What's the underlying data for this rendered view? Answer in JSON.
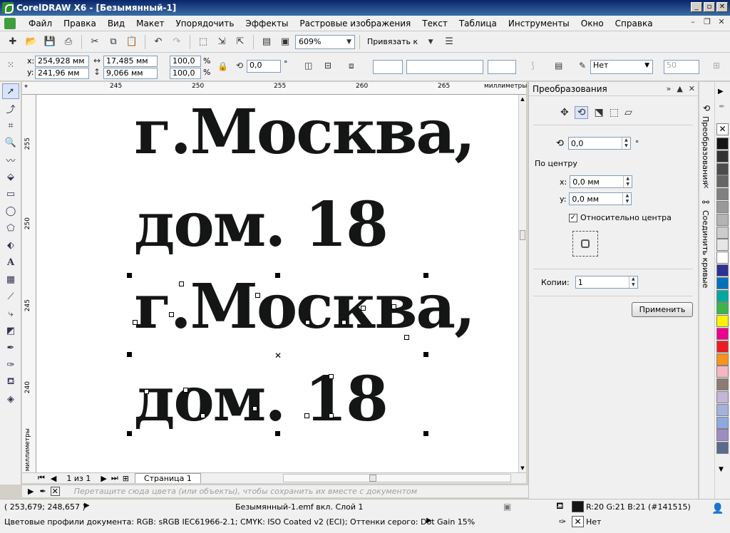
{
  "window": {
    "title": "CorelDRAW X6 - [Безымянный-1]"
  },
  "menu": [
    "Файл",
    "Правка",
    "Вид",
    "Макет",
    "Упорядочить",
    "Эффекты",
    "Растровые изображения",
    "Текст",
    "Таблица",
    "Инструменты",
    "Окно",
    "Справка"
  ],
  "toolbar": {
    "zoom": "609%",
    "snap_label": "Привязать к"
  },
  "props": {
    "x": "254,928 мм",
    "y": "241,96 мм",
    "width": "17,485 мм",
    "height": "9,066 мм",
    "scale_x": "100,0",
    "scale_y": "100,0",
    "pct": "%",
    "angle": "0,0",
    "deg": "°",
    "outline": "Нет",
    "outline_width": "50"
  },
  "ruler": {
    "h_ticks": [
      "245",
      "250",
      "255",
      "260",
      "265"
    ],
    "h_unit": "миллиметры",
    "v_ticks": [
      "255",
      "250",
      "245",
      "240"
    ],
    "v_unit": "миллиметры"
  },
  "canvas": {
    "line1": "г.Москва,",
    "line2": "дом. 18",
    "line3": "г.Москва,",
    "line4": "дом. 18"
  },
  "pager": {
    "page_count": "1 из 1",
    "page_tab": "Страница 1"
  },
  "colorbar": {
    "hint": "Перетащите сюда цвета (или объекты), чтобы сохранить их вместе с документом"
  },
  "docker": {
    "title": "Преобразования",
    "angle": "0,0",
    "deg": "°",
    "center_label": "По центру",
    "x_label": "x:",
    "x_value": "0,0 мм",
    "y_label": "y:",
    "y_value": "0,0 мм",
    "relative_label": "Относительно центра",
    "relative_checked": true,
    "copies_label": "Копии:",
    "copies_value": "1",
    "apply": "Применить"
  },
  "vtabs": {
    "tab1": "Преобразования",
    "tab2": "Соединить кривые"
  },
  "status": {
    "coords": "( 253,679; 248,657 )",
    "doc_info": "Безымянный-1.emf вкл. Слой 1",
    "color_profiles": "Цветовые профили документа: RGB: sRGB IEC61966-2.1; CMYK: ISO Coated v2 (ECI); Оттенки серого: Dot Gain 15%",
    "fill_info": "R:20 G:21 B:21 (#141515)",
    "outline_info": "Нет",
    "fill_color": "#141515"
  },
  "palette": [
    "#141414",
    "#333333",
    "#4d4d4d",
    "#666666",
    "#808080",
    "#999999",
    "#b3b3b3",
    "#cccccc",
    "#e6e6e6",
    "#ffffff",
    "#2e3192",
    "#0072bc",
    "#00a99d",
    "#39b54a",
    "#fff200",
    "#ec008c",
    "#ed1c24",
    "#f7941d",
    "#f5b6c1",
    "#8c7b70",
    "#c4b5d9",
    "#a3b1dc",
    "#8fa8e0",
    "#9e8cc2",
    "#5a6b8c"
  ]
}
